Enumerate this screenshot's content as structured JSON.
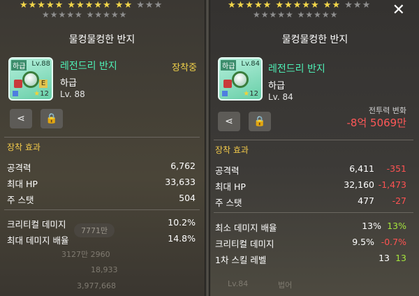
{
  "left": {
    "stars_top": "★★★★★ ★★★★★ ★★",
    "stars_top_dim": "★★★",
    "stars_bottom": "★★★★★ ★★★★★",
    "title": "물컹물컹한 반지",
    "icon": {
      "grade": "하급",
      "level": "Lv.88",
      "enhance": "12",
      "badge": "E"
    },
    "name": "레전드리 반지",
    "grade": "하급",
    "level": "Lv. 88",
    "equipped": "장착중",
    "section": "장착 효과",
    "stats": [
      {
        "label": "공격력",
        "value": "6,762"
      },
      {
        "label": "최대 HP",
        "value": "33,633"
      },
      {
        "label": "주 스탯",
        "value": "504"
      }
    ],
    "stats2": [
      {
        "label": "크리티컬 데미지",
        "value": "10.2%"
      },
      {
        "label": "최대 데미지 배율",
        "value": "14.8%"
      }
    ],
    "bg_numbers": [
      "7771만",
      "3127만 2960",
      "18,933",
      "3,977,668"
    ]
  },
  "right": {
    "stars_top": "★★★★★ ★★★★★ ★★",
    "stars_top_dim": "★★★",
    "stars_bottom": "★★★★★ ★★★★★",
    "close": "✕",
    "title": "물컹물컹한 반지",
    "icon": {
      "grade": "하급",
      "level": "Lv.84",
      "enhance": "12"
    },
    "name": "레전드리 반지",
    "grade": "하급",
    "level": "Lv. 84",
    "power_label": "전투력 변화",
    "power_value": "-8억 5069만",
    "section": "장착 효과",
    "stats": [
      {
        "label": "공격력",
        "value": "6,411",
        "diff": "-351"
      },
      {
        "label": "최대 HP",
        "value": "32,160",
        "diff": "-1,473"
      },
      {
        "label": "주 스탯",
        "value": "477",
        "diff": "-27"
      }
    ],
    "stats2": [
      {
        "label": "최소 데미지 배율",
        "value": "13%",
        "diff": "13%"
      },
      {
        "label": "크리티컬 데미지",
        "value": "9.5%",
        "diff": "-0.7%"
      },
      {
        "label": "1차 스킬 레벨",
        "value": "13",
        "diff": "13"
      }
    ],
    "bg_texts": [
      "Lv.84",
      "법어"
    ]
  },
  "colors": {
    "name": "#4ef0b6",
    "equipped": "#f2d24a",
    "negative": "#ff5252",
    "positive": "#a5e53c",
    "section": "#f2c94a"
  }
}
